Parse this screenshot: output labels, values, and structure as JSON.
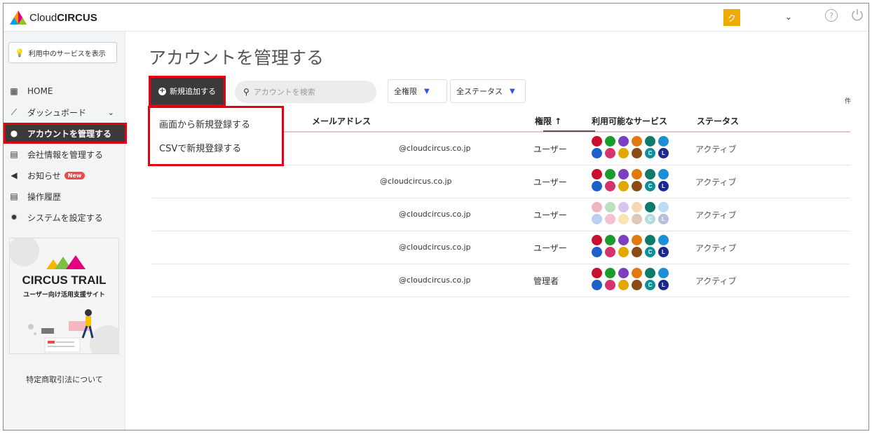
{
  "app": {
    "logo_cloud": "Cloud",
    "logo_circus": "CIRCUS",
    "avatar_initial": "ク"
  },
  "sidebar": {
    "service_button": "利用中のサービスを表示",
    "items": [
      {
        "label": "HOME",
        "icon": "grid-icon",
        "glyph": "▦"
      },
      {
        "label": "ダッシュボード",
        "icon": "chart-icon",
        "glyph": "⟋"
      },
      {
        "label": "アカウントを管理する",
        "icon": "user-icon",
        "glyph": "●"
      },
      {
        "label": "会社情報を管理する",
        "icon": "document-icon",
        "glyph": "▤"
      },
      {
        "label": "お知らせ",
        "icon": "megaphone-icon",
        "glyph": "◀",
        "badge": "New"
      },
      {
        "label": "操作履歴",
        "icon": "list-icon",
        "glyph": "▤"
      },
      {
        "label": "システムを設定する",
        "icon": "gear-icon",
        "glyph": "✹"
      }
    ],
    "banner_title": "CIRCUS TRAIL",
    "banner_sub": "ユーザー向け活用支援サイト",
    "legal_link": "特定商取引法について"
  },
  "main": {
    "title": "アカウントを管理する",
    "add_button": "新規追加する",
    "search_placeholder": "アカウントを検索",
    "role_filter": "全権限",
    "status_filter": "全ステータス",
    "count_unit": "件",
    "add_menu": [
      "画面から新規登録する",
      "CSVで新規登録する"
    ]
  },
  "table": {
    "headers": {
      "email": "メールアドレス",
      "role": "権限 ↑",
      "services": "利用可能なサービス",
      "status": "ステータス"
    },
    "rows": [
      {
        "email": "@cloudcircus.co.jp",
        "role": "ユーザー",
        "status": "アクティブ"
      },
      {
        "email": "@cloudcircus.co.jp",
        "role": "ユーザー",
        "status": "アクティブ"
      },
      {
        "email": "@cloudcircus.co.jp",
        "role": "ユーザー",
        "status": "アクティブ"
      },
      {
        "email": "@cloudcircus.co.jp",
        "role": "ユーザー",
        "status": "アクティブ"
      },
      {
        "email": "@cloudcircus.co.jp",
        "role": "管理者",
        "status": "アクティブ"
      }
    ]
  },
  "colors": {
    "accent_red": "#e50012",
    "dark": "#3a3a3a",
    "avatar": "#f0ab00",
    "service_dots": [
      "#c8102e",
      "#1a9c2a",
      "#7b3fbf",
      "#e07a10",
      "#0f7a6a",
      "#1d8fd6",
      "#1e5fc9",
      "#d6336c",
      "#e0a800",
      "#8a4b14",
      "#0b8f9a",
      "#1b2a8a"
    ]
  }
}
